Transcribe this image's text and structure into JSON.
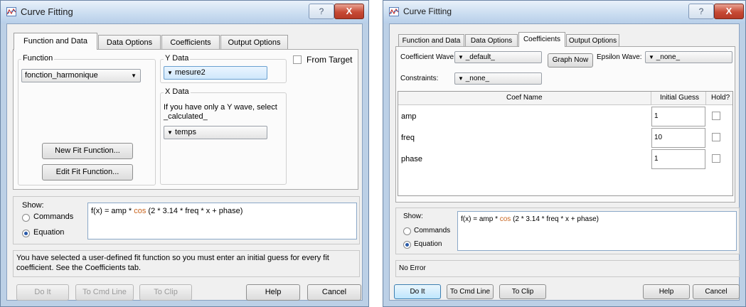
{
  "left": {
    "title": "Curve Fitting",
    "tabs": [
      "Function and Data",
      "Data Options",
      "Coefficients",
      "Output Options"
    ],
    "function_label": "Function",
    "function_value": "fonction_harmonique",
    "ydata_label": "Y Data",
    "ydata_value": "mesure2",
    "from_target_label": "From Target",
    "xdata_label": "X Data",
    "xdata_hint_1": "If you have only a Y wave, select",
    "xdata_hint_2": "_calculated_",
    "xdata_value": "temps",
    "new_fit_label": "New Fit Function...",
    "edit_fit_label": "Edit Fit Function...",
    "show_label": "Show:",
    "commands_label": "Commands",
    "equation_label": "Equation",
    "eq_pre": "f(x) = amp * ",
    "eq_cos": "cos",
    "eq_post": " (2 * 3.14 * freq * x + phase)",
    "message_1": "You have selected a user-defined fit function so you must enter an initial guess for every fit",
    "message_2": "coefficient. See the Coefficients tab.",
    "doit_label": "Do It",
    "cmdline_label": "To Cmd Line",
    "clip_label": "To Clip",
    "help_label": "Help",
    "cancel_label": "Cancel"
  },
  "right": {
    "title": "Curve Fitting",
    "tabs": [
      "Function and Data",
      "Data Options",
      "Coefficients",
      "Output Options"
    ],
    "coef_wave_label": "Coefficient Wave:",
    "coef_wave_value": "_default_",
    "graph_now_label": "Graph Now",
    "epsilon_label": "Epsilon Wave:",
    "epsilon_value": "_none_",
    "constraints_label": "Constraints:",
    "constraints_value": "_none_",
    "table_headers": [
      "Coef Name",
      "Initial Guess",
      "Hold?"
    ],
    "rows": [
      {
        "name": "amp",
        "guess": "1"
      },
      {
        "name": "freq",
        "guess": "10"
      },
      {
        "name": "phase",
        "guess": "1"
      }
    ],
    "show_label": "Show:",
    "commands_label": "Commands",
    "equation_label": "Equation",
    "eq_pre": "f(x) = amp * ",
    "eq_cos": "cos",
    "eq_post": " (2 * 3.14 * freq * x + phase)",
    "status": "No Error",
    "doit_label": "Do It",
    "cmdline_label": "To Cmd Line",
    "clip_label": "To Clip",
    "help_label": "Help",
    "cancel_label": "Cancel"
  },
  "icons": {
    "help": "?",
    "close": "X",
    "dropdown": "▼",
    "app": "curve-fitting-icon"
  },
  "colors": {
    "keyword": "#c8641e",
    "accent": "#2a5aa8"
  }
}
